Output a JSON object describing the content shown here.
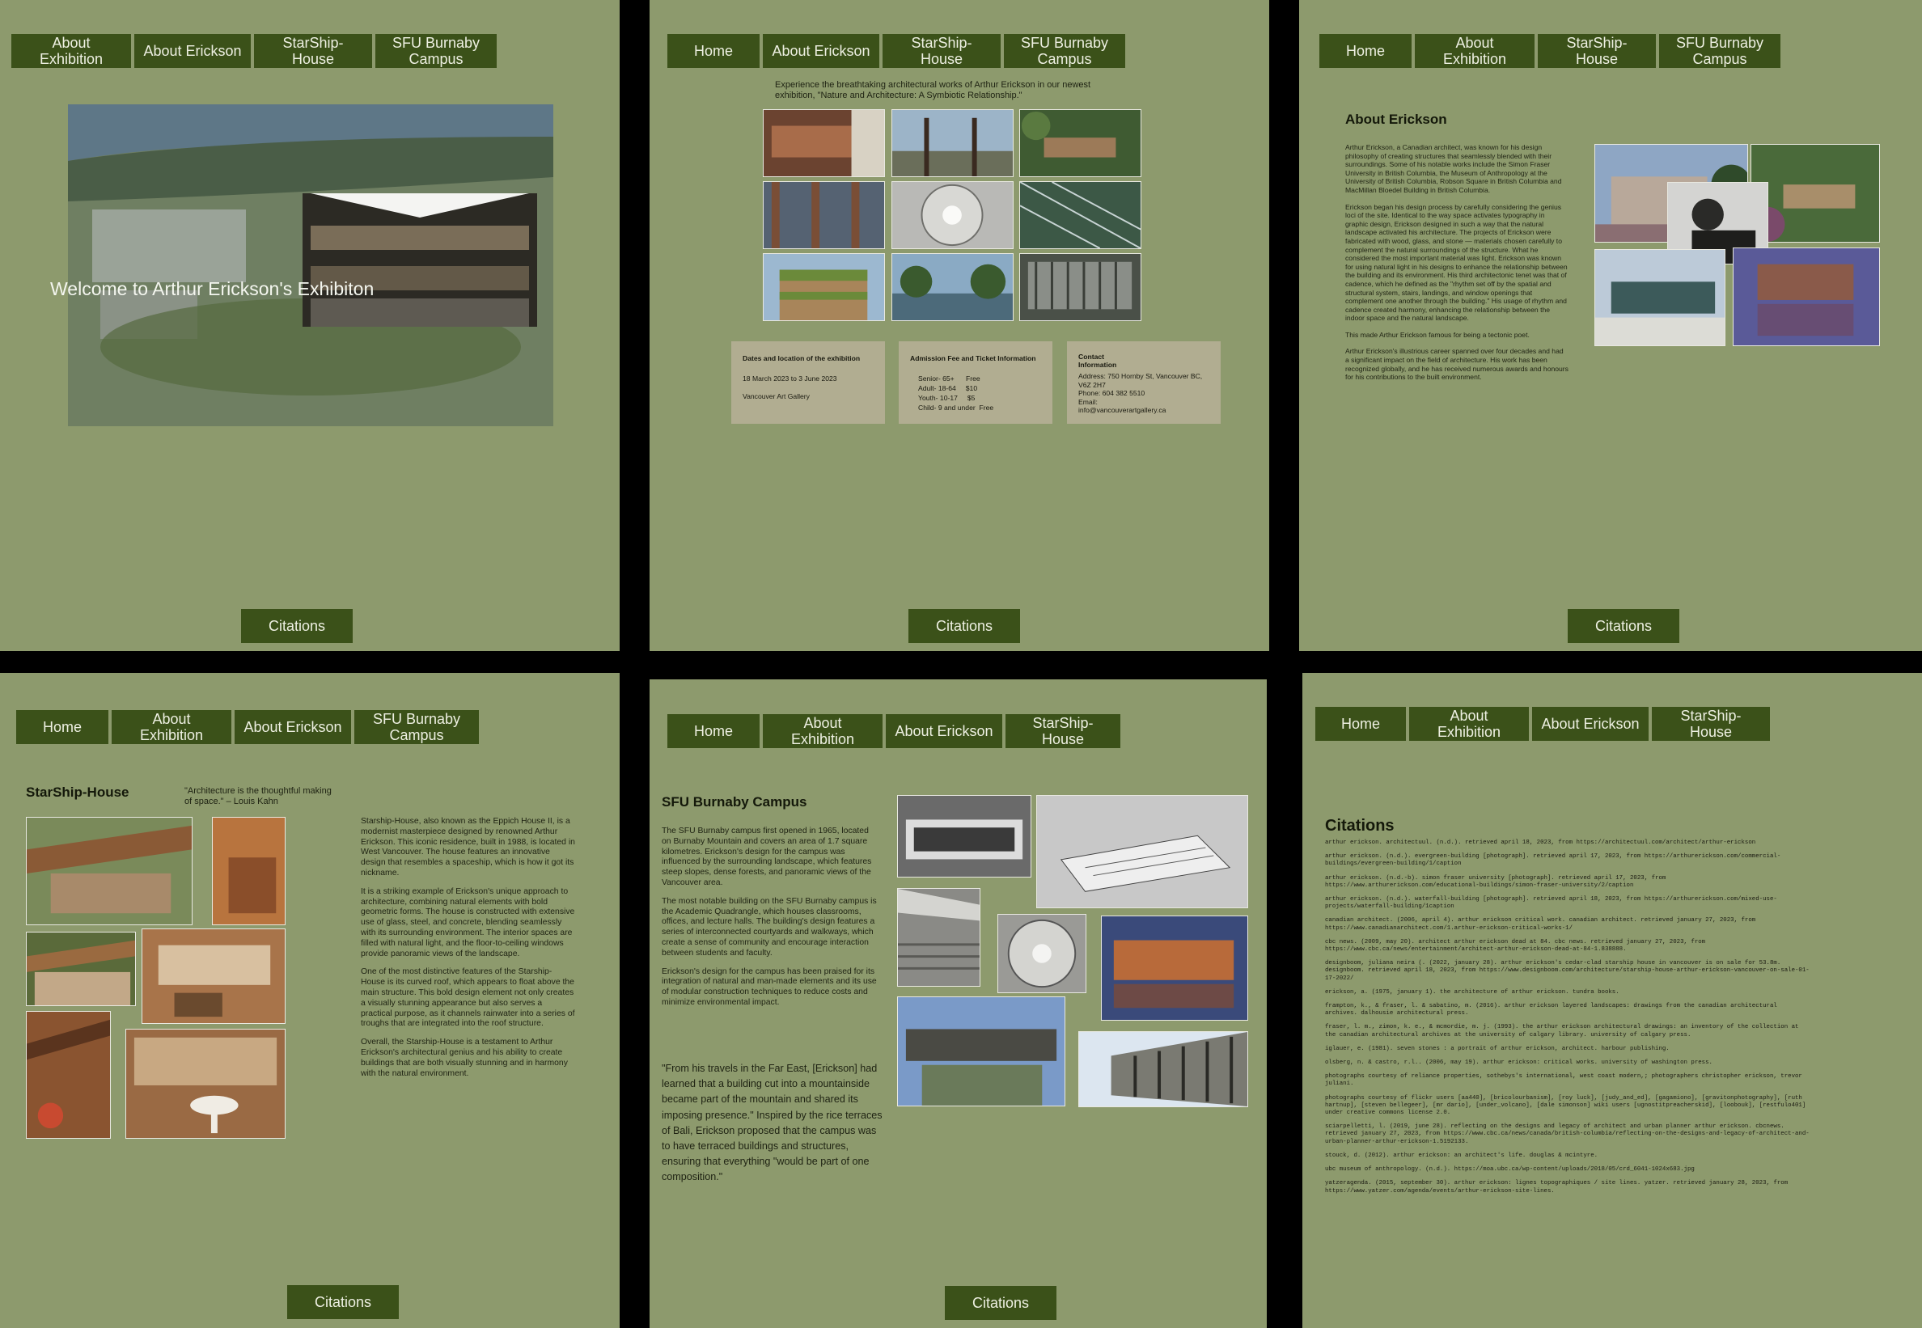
{
  "home": {
    "nav": [
      "About Exhibition",
      "About Erickson",
      "StarShip-House",
      "SFU Burnaby Campus"
    ],
    "welcome": "Welcome to Arthur Erickson's Exhibiton",
    "citations_button": "Citations"
  },
  "exhibition": {
    "nav": [
      "Home",
      "About Erickson",
      "StarShip-House",
      "SFU Burnaby Campus"
    ],
    "intro_line1": "Experience the breathtaking architectural works of Arthur Erickson in our newest",
    "intro_line2": "exhibition, \"Nature and Architecture: A Symbiotic Relationship.\"",
    "box1": {
      "title": "Dates and location of the exhibition",
      "lines": [
        "18 March 2023 to 3 June 2023",
        "Vancouver Art Gallery"
      ]
    },
    "box2": {
      "title": "Admission Fee and Ticket Information",
      "lines": [
        "Senior- 65+      Free",
        "Adult- 18-64     $10",
        "Youth- 10-17     $5",
        "Child- 9 and under  Free"
      ]
    },
    "box3": {
      "title": "Contact\nInformation",
      "lines": [
        "Address: 750 Hornby St, Vancouver BC,",
        "V6Z 2H7",
        "Phone: 604 382 5510",
        "Email:",
        "info@vancouverartgallery.ca"
      ]
    },
    "citations_button": "Citations"
  },
  "about": {
    "nav": [
      "Home",
      "About Exhibition",
      "StarShip-House",
      "SFU Burnaby Campus"
    ],
    "title": "About Erickson",
    "p1": "Arthur Erickson, a Canadian architect, was known for his design philosophy of creating structures that seamlessly blended with their surroundings. Some of his notable works include the Simon Fraser University in British Columbia, the Museum of Anthropology at the University of British Columbia, Robson Square in British Columbia and MacMillan Bloedel Building in British Columbia.",
    "p2": "Erickson began his design process by carefully considering the genius loci of the site. Identical to the way space activates typography in graphic design, Erickson designed in such a way that the natural landscape activated his architecture. The projects of Erickson were fabricated with wood, glass, and stone — materials chosen carefully to complement the natural surroundings of the structure. What he considered the most important material was light. Erickson was known for using natural light in his designs to enhance the relationship between the building and its environment. His third architectonic tenet was that of cadence, which he defined as the \"rhythm set off by the spatial and structural system, stairs, landings, and window openings that complement one another through the building.\" His usage of rhythm and cadence created harmony, enhancing the relationship between the indoor space and the natural landscape.",
    "p3": "This made Arthur Erickson famous for being a tectonic poet.",
    "p4": "Arthur Erickson's illustrious career spanned over four decades and had a significant impact on the field of architecture. His work has been recognized globally, and he has received numerous awards and honours for his contributions to the built environment.",
    "citations_button": "Citations"
  },
  "starship": {
    "nav": [
      "Home",
      "About Exhibition",
      "About Erickson",
      "SFU Burnaby Campus"
    ],
    "title": "StarShip-House",
    "quote": "\"Architecture is the thoughtful making of space.\" – Louis Kahn",
    "p1": "Starship-House, also known as the Eppich House II, is a modernist masterpiece designed by renowned Arthur Erickson. This iconic residence, built in 1988, is located in West Vancouver. The house features an innovative design that resembles a spaceship, which is how it got its nickname.",
    "p2": "It is a striking example of Erickson's unique approach to architecture, combining natural elements with bold geometric forms. The house is constructed with extensive use of glass, steel, and concrete, blending seamlessly with its surrounding environment. The interior spaces are filled with natural light, and the floor-to-ceiling windows provide panoramic views of the landscape.",
    "p3": "One of the most distinctive features of the Starship-House is its curved roof, which appears to float above the main structure. This bold design element not only creates a visually stunning appearance but also serves a practical purpose, as it channels rainwater into a series of troughs that are integrated into the roof structure.",
    "p4": "Overall, the Starship-House is a testament to Arthur Erickson's architectural genius and his ability to create buildings that are both visually stunning and in harmony with the natural environment.",
    "citations_button": "Citations"
  },
  "sfu": {
    "nav": [
      "Home",
      "About Exhibition",
      "About Erickson",
      "StarShip-House"
    ],
    "title": "SFU Burnaby Campus",
    "p1": "The SFU Burnaby campus first opened in 1965, located on Burnaby Mountain and covers an area of 1.7 square kilometres. Erickson's design for the campus was influenced by the surrounding landscape, which features steep slopes, dense forests, and panoramic views of the Vancouver area.",
    "p2": "The most notable building on the SFU Burnaby campus is the Academic Quadrangle, which houses classrooms, offices, and lecture halls. The building's design features a series of interconnected courtyards and walkways, which create a sense of community and encourage interaction between students and faculty.",
    "p3": "Erickson's design for the campus has been praised for its integration of natural and man-made elements and its use of modular construction techniques to reduce costs and minimize environmental impact.",
    "quote": "\"From his travels in the Far East, [Erickson] had learned that a building cut into a mountainside became part of the mountain and shared its imposing presence.\" Inspired by the rice terraces of Bali, Erickson proposed that the campus was to have terraced buildings and structures, ensuring that everything \"would be part of one composition.\"",
    "citations_button": "Citations"
  },
  "citations": {
    "nav": [
      "Home",
      "About Exhibition",
      "About Erickson",
      "StarShip-House"
    ],
    "title": "Citations",
    "entries": [
      "arthur erickson. architectuul. (n.d.). retrieved april 18, 2023, from https://architectuul.com/architect/arthur-erickson",
      "arthur erickson. (n.d.). evergreen-building [photograph]. retrieved april 17, 2023, from https://arthurerickson.com/commercial-buildings/evergreen-building/1/caption",
      "arthur erickson. (n.d.-b). simon fraser university [photograph]. retrieved april 17, 2023, from https://www.arthurerickson.com/educational-buildings/simon-fraser-university/2/caption",
      "arthur erickson. (n.d.). waterfall-building [photograph]. retrieved april 18, 2023, from https://arthurerickson.com/mixed-use-projects/waterfall-building/1caption",
      "canadian architect. (2006, april 4). arthur erickson critical work. canadian architect. retrieved january 27, 2023, from https://www.canadianarchitect.com/1.arthur-erickson-critical-works-1/",
      "cbc news. (2009, may 20). architect arthur erickson dead at 84. cbc news. retrieved january 27, 2023, from https://www.cbc.ca/news/entertainment/architect-arthur-erickson-dead-at-84-1.838888.",
      "designboom, juliana neira (. (2022, january 28). arthur erickson's cedar-clad starship house in vancouver is on sale for 53.8m. designboom. retrieved april 18, 2023, from https://www.designboom.com/architecture/starship-house-arthur-erickson-vancouver-on-sale-01-17-2022/",
      "erickson, a. (1975, january 1). the architecture of arthur erickson. tundra books.",
      "frampton, k., & fraser, l. & sabatino, m. (2016). arthur erickson layered landscapes: drawings from the canadian architectural archives. dalhousie architectural press.",
      "fraser, l. m., zimon, k. e., & mcmordie, m. j. (1993). the arthur erickson architectural drawings: an inventory of the collection at the canadian architectural archives at the university of calgary library. university of calgary press.",
      "iglauer, e. (1981). seven stones : a portrait of arthur erickson, architect. harbour publishing.",
      "olsberg, n. & castro, r.l.. (2006, may 19). arthur erickson: critical works. university of washington press.",
      "photographs courtesy of reliance properties, sothebys's international, west coast modern,; photographers christopher erickson, trevor juliani.",
      "photographs courtesy of flickr users [aa440], [bricolourbanism], [roy luck], [judy_and_ed], [gagamiono], [gravitonphotography], [ruth hartnup], [steven bellegeer], [mr dario], [under_volcano], [dale simonson] wiki users [ugnostitpreacherskid], [loobouk], [restfulo401] under creative commons license 2.0.",
      "sciarpelletti, l. (2019, june 28). reflecting on the designs and legacy of architect and urban planner arthur erickson. cbcnews. retrieved january 27, 2023, from https://www.cbc.ca/news/canada/british-columbia/reflecting-on-the-designs-and-legacy-of-architect-and-urban-planner-arthur-erickson-1.5192133.",
      "stouck, d. (2012). arthur erickson: an architect's life. douglas & mcintyre.",
      "ubc museum of anthropology. (n.d.). https://moa.ubc.ca/wp-content/uploads/2018/05/crd_6041-1024x683.jpg",
      "yatzeragenda. (2015, september 30). arthur erickson: lignes topographiques / site lines. yatzer. retrieved january 28, 2023, from https://www.yatzer.com/agenda/events/arthur-erickson-site-lines."
    ]
  },
  "colors": {
    "panel_bg": "#8d9a6d",
    "button_bg": "#3b5119",
    "button_text": "#eef0e2",
    "info_box": "#b1ad91"
  }
}
